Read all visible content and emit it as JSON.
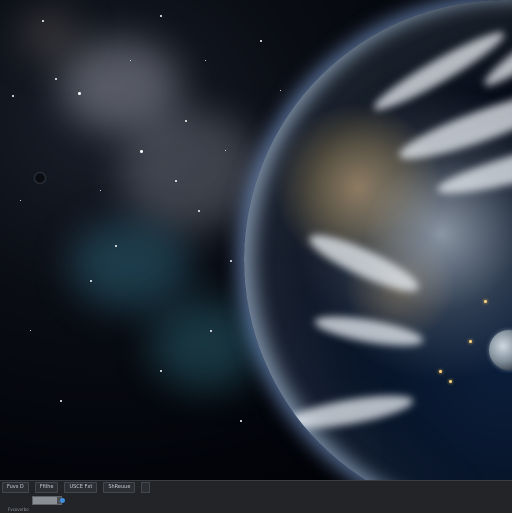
{
  "toolbar": {
    "tabs": [
      {
        "label": "Fuvs D"
      },
      {
        "label": "Ffilhe"
      },
      {
        "label": "USCE Fxt"
      },
      {
        "label": "ShReuue"
      }
    ],
    "progress": 0.85,
    "status": "Fvsovorbo"
  },
  "colors": {
    "accent": "#3d8fe0",
    "toolbar_bg": "#222428",
    "atmosphere": "#96beff"
  }
}
